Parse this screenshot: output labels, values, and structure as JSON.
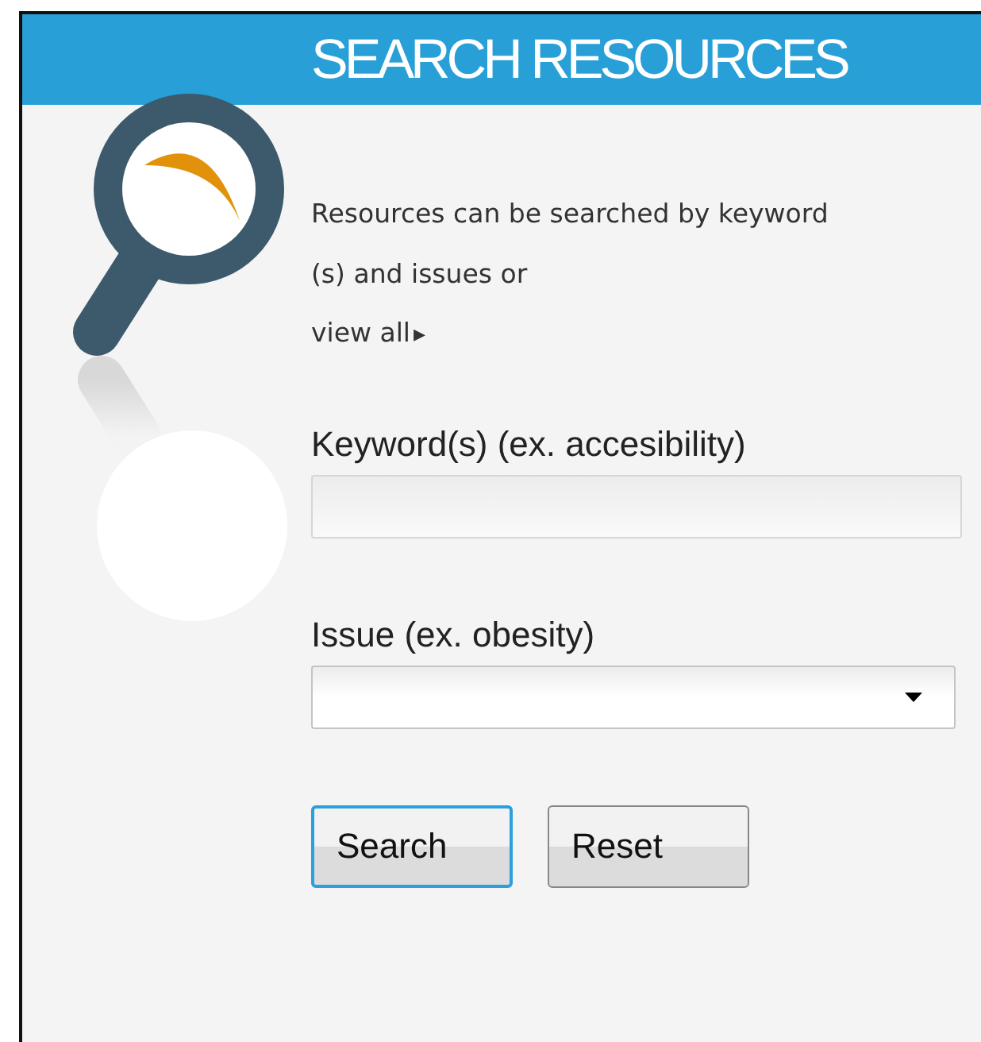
{
  "header": {
    "title": "SEARCH RESOURCES"
  },
  "intro_lines": [
    "Resources can be searched by keyword",
    "(s) and issues or"
  ],
  "view_all_link": {
    "label": "view all",
    "arrow": "▸"
  },
  "keyword_field": {
    "label": "Keyword(s) (ex. accesibility)"
  },
  "issue_select": {
    "label": "Issue (ex. obesity)"
  },
  "buttons": [
    {
      "label": "Search",
      "focused": true
    },
    {
      "label": "Reset",
      "focused": false
    }
  ]
}
